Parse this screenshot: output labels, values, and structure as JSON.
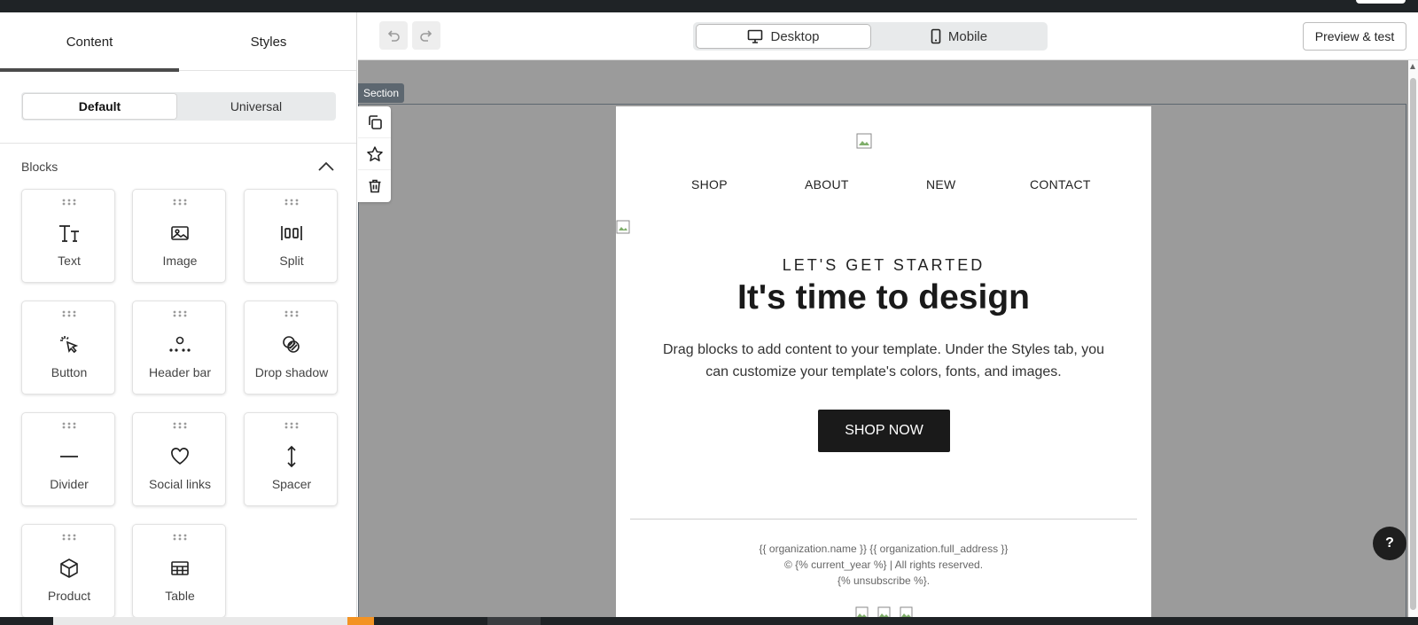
{
  "sidebar": {
    "tabs": [
      {
        "label": "Content"
      },
      {
        "label": "Styles"
      }
    ],
    "mode_toggle": {
      "default_label": "Default",
      "universal_label": "Universal"
    },
    "blocks_title": "Blocks",
    "blocks": [
      {
        "label": "Text",
        "icon": "text-icon"
      },
      {
        "label": "Image",
        "icon": "image-icon"
      },
      {
        "label": "Split",
        "icon": "split-icon"
      },
      {
        "label": "Button",
        "icon": "cursor-click-icon"
      },
      {
        "label": "Header bar",
        "icon": "header-bar-icon"
      },
      {
        "label": "Drop shadow",
        "icon": "drop-shadow-icon"
      },
      {
        "label": "Divider",
        "icon": "divider-icon"
      },
      {
        "label": "Social links",
        "icon": "heart-icon"
      },
      {
        "label": "Spacer",
        "icon": "spacer-icon"
      },
      {
        "label": "Product",
        "icon": "cube-icon"
      },
      {
        "label": "Table",
        "icon": "table-icon"
      }
    ]
  },
  "toolbar": {
    "device_desktop": "Desktop",
    "device_mobile": "Mobile",
    "preview_label": "Preview & test"
  },
  "canvas": {
    "section_tag": "Section",
    "email": {
      "nav": [
        "SHOP",
        "ABOUT",
        "NEW",
        "CONTACT"
      ],
      "eyebrow": "LET'S GET STARTED",
      "headline": "It's time to design",
      "body": "Drag blocks to add content to your template. Under the Styles tab, you can customize your template's colors, fonts, and images.",
      "cta": "SHOP NOW",
      "footer": {
        "line1": "{{ organization.name }} {{ organization.full_address }}",
        "line2": "© {% current_year %} | All rights reserved.",
        "line3": "{% unsubscribe %}."
      }
    }
  },
  "help_label": "?",
  "colors": {
    "accent_dark": "#1a1a1a",
    "canvas_bg": "#9b9b9b",
    "section_outline": "#5d6770"
  }
}
